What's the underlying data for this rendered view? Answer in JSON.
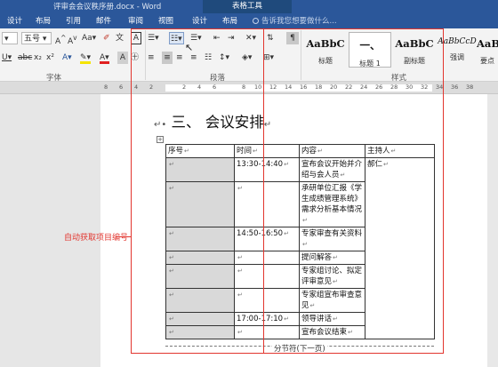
{
  "titlebar": {
    "title": "评审会会议秩序册.docx - Word",
    "context_tab": "表格工具"
  },
  "tabs": [
    {
      "label": "设计"
    },
    {
      "label": "布局"
    },
    {
      "label": "引用"
    },
    {
      "label": "邮件"
    },
    {
      "label": "审阅"
    },
    {
      "label": "视图"
    },
    {
      "label": "设计"
    },
    {
      "label": "布局"
    }
  ],
  "tell_me": {
    "placeholder": "告诉我您想要做什么..."
  },
  "ribbon": {
    "font_group_label": "字体",
    "paragraph_group_label": "段落",
    "styles_group_label": "样式",
    "font_size_value": "五号",
    "styles": [
      {
        "sample": "AaBbC",
        "name": "标题"
      },
      {
        "sample": "一、",
        "name": "标题 1"
      },
      {
        "sample": "AaBbC",
        "name": "副标题"
      },
      {
        "sample": "AaBbCcD",
        "name": "强调"
      },
      {
        "sample": "AaBb",
        "name": "要点"
      }
    ]
  },
  "ruler": {
    "ticks": [
      "8",
      "6",
      "4",
      "2",
      "2",
      "4",
      "6",
      "8",
      "10",
      "12",
      "14",
      "16",
      "18",
      "20",
      "22",
      "24",
      "26",
      "28",
      "30",
      "32",
      "34",
      "36",
      "38"
    ]
  },
  "document": {
    "heading": "三、 会议安排",
    "table": {
      "headers": [
        "序号",
        "时间",
        "内容",
        "主持人"
      ],
      "rows": [
        {
          "time": "13:30-14:40",
          "content": "宣布会议开始并介绍与会人员",
          "host": "郝仁"
        },
        {
          "time": "",
          "content": "承研单位汇报《学生成绩管理系统》需求分析基本情况",
          "host": ""
        },
        {
          "time": "14:50-16:50",
          "content": "专家审查有关资料",
          "host": ""
        },
        {
          "time": "",
          "content": "提问解答",
          "host": ""
        },
        {
          "time": "",
          "content": "专家组讨论、拟定评审意见",
          "host": ""
        },
        {
          "time": "",
          "content": "专家组宣布审查意见",
          "host": ""
        },
        {
          "time": "17:00-17:10",
          "content": "领导讲话",
          "host": ""
        },
        {
          "time": "",
          "content": "宣布会议结束",
          "host": ""
        }
      ]
    },
    "section_break": "分节符(下一页)"
  },
  "annotation": {
    "label": "自动获取项目编号",
    "color": "#e2352e"
  },
  "colors": {
    "word_blue": "#2b579a",
    "annotation_red": "#e2352e"
  }
}
